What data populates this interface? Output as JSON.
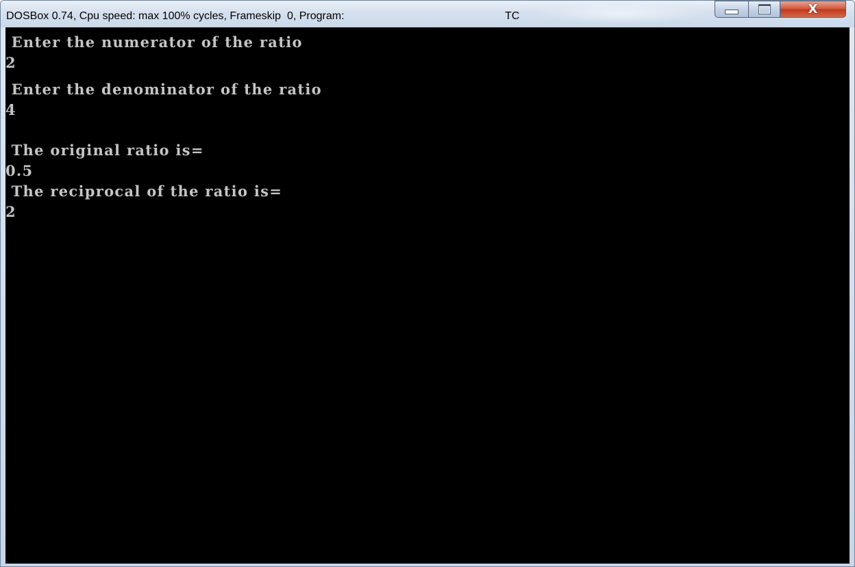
{
  "window": {
    "title": "DOSBox 0.74, Cpu speed: max 100% cycles, Frameskip  0, Program:",
    "program": "TC",
    "close_label": "X"
  },
  "console": {
    "lines": [
      " Enter the numerator of the ratio",
      "2",
      " Enter the denominator of the ratio",
      "4",
      "",
      " The original ratio is=",
      "0.5",
      " The reciprocal of the ratio is=",
      "2"
    ]
  },
  "colors": {
    "text": "#c4c4c4",
    "background": "#000000",
    "close_button": "#c94a2e"
  },
  "icons": [
    "minimize-icon",
    "maximize-icon",
    "close-icon"
  ]
}
